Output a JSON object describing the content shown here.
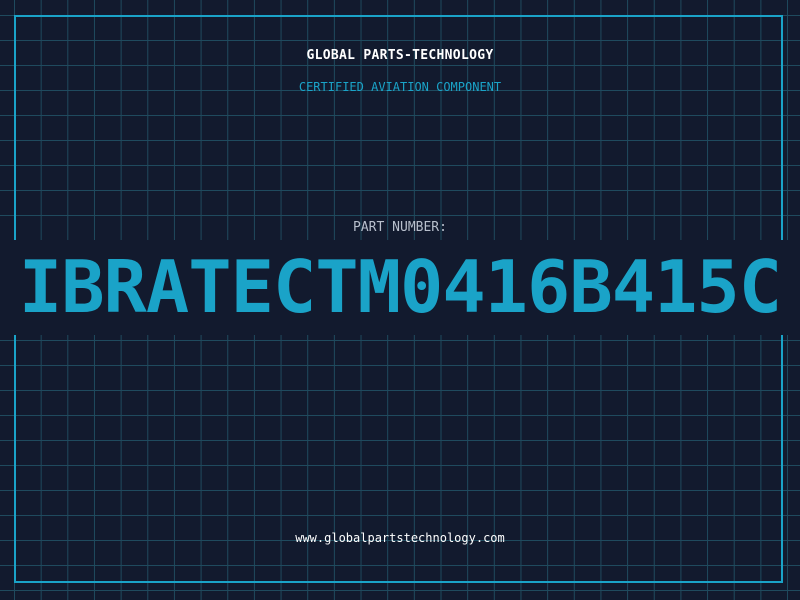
{
  "header": {
    "company": "GLOBAL PARTS-TECHNOLOGY",
    "tagline": "CERTIFIED AVIATION COMPONENT"
  },
  "part": {
    "label": "PART NUMBER:",
    "number": "IBRATECTM0416B415C"
  },
  "footer": {
    "url": "www.globalpartstechnology.com"
  },
  "colors": {
    "background": "#121a2e",
    "accent": "#1aa3c8",
    "grid": "#1f4a5e"
  }
}
